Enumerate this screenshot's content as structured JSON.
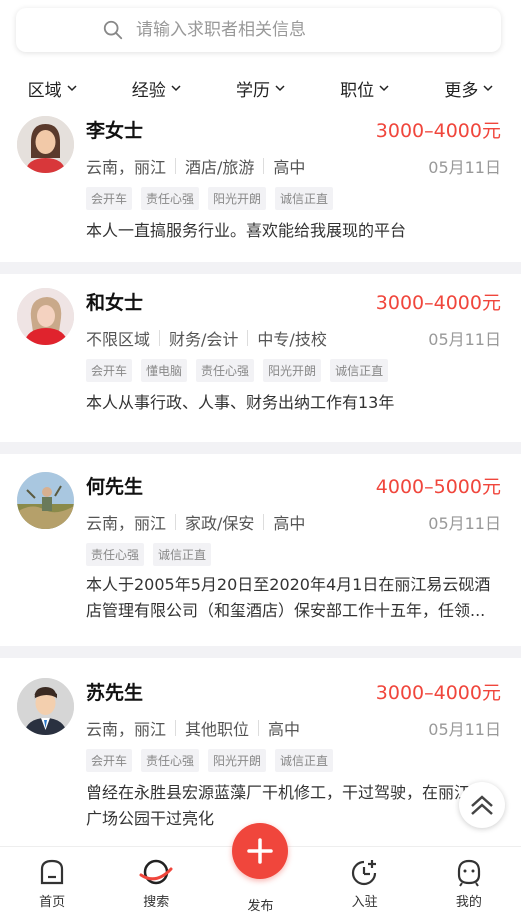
{
  "search": {
    "placeholder": "请输入求职者相关信息"
  },
  "filters": [
    "区域",
    "经验",
    "学历",
    "职位",
    "更多"
  ],
  "cards": [
    {
      "name": "李女士",
      "salary": "3000–4000元",
      "meta": [
        "云南，丽江",
        "酒店/旅游",
        "高中"
      ],
      "date": "05月11日",
      "tags": [
        "会开车",
        "责任心强",
        "阳光开朗",
        "诚信正直"
      ],
      "desc": "本人一直搞服务行业。喜欢能给我展现的平台"
    },
    {
      "name": "和女士",
      "salary": "3000–4000元",
      "meta": [
        "不限区域",
        "财务/会计",
        "中专/技校"
      ],
      "date": "05月11日",
      "tags": [
        "会开车",
        "懂电脑",
        "责任心强",
        "阳光开朗",
        "诚信正直"
      ],
      "desc": "本人从事行政、人事、财务出纳工作有13年"
    },
    {
      "name": "何先生",
      "salary": "4000–5000元",
      "meta": [
        "云南，丽江",
        "家政/保安",
        "高中"
      ],
      "date": "05月11日",
      "tags": [
        "责任心强",
        "诚信正直"
      ],
      "desc": "本人于2005年5月20日至2020年4月1日在丽江易云砚酒店管理有限公司（和玺酒店）保安部工作十五年，任领..."
    },
    {
      "name": "苏先生",
      "salary": "3000–4000元",
      "meta": [
        "云南，丽江",
        "其他职位",
        "高中"
      ],
      "date": "05月11日",
      "tags": [
        "会开车",
        "责任心强",
        "阳光开朗",
        "诚信正直"
      ],
      "desc": "曾经在永胜县宏源蓝藻厂干机修工，干过驾驶，在丽江各广场公园干过亮化"
    }
  ],
  "tabs": {
    "home": "首页",
    "search": "搜索",
    "publish": "发布",
    "join": "入驻",
    "mine": "我的"
  },
  "colors": {
    "accent": "#f0463c"
  }
}
